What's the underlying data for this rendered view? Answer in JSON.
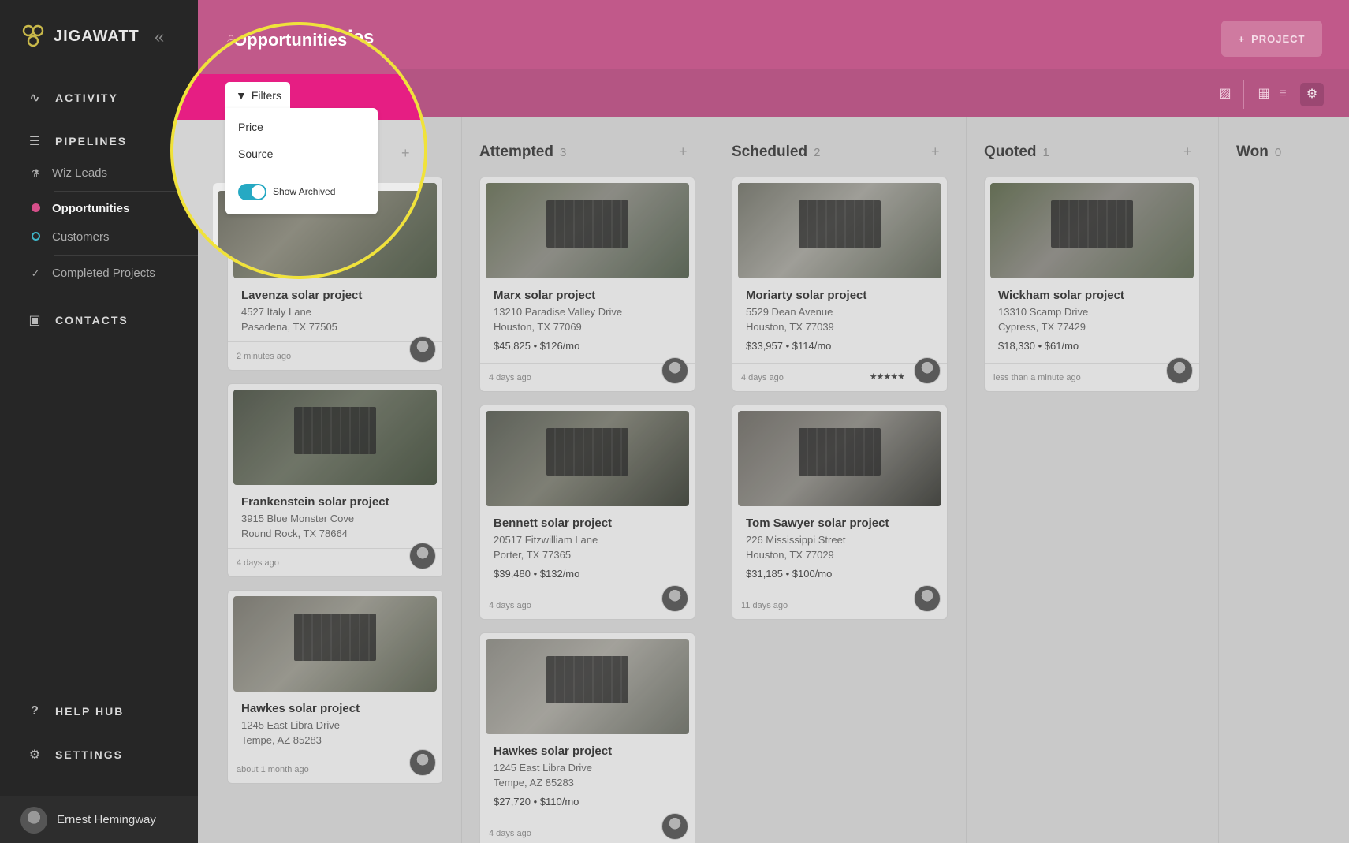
{
  "app": {
    "name": "JIGAWATT"
  },
  "sidebar": {
    "sections": [
      {
        "label": "ACTIVITY",
        "icon": "activity-icon"
      },
      {
        "label": "PIPELINES",
        "icon": "list-icon"
      },
      {
        "label": "CONTACTS",
        "icon": "contact-card-icon"
      },
      {
        "label": "HELP HUB",
        "icon": "help-icon"
      },
      {
        "label": "SETTINGS",
        "icon": "gear-icon"
      }
    ],
    "pipelines": [
      {
        "label": "Wiz Leads",
        "icon": "wizard-icon"
      },
      {
        "label": "Opportunities",
        "icon": "dot-icon",
        "color": "#d64f8a",
        "active": true
      },
      {
        "label": "Customers",
        "icon": "ring-icon",
        "color": "#3fb6c9"
      },
      {
        "label": "Completed Projects",
        "icon": "check-icon"
      }
    ],
    "user": {
      "name": "Ernest Hemingway"
    }
  },
  "header": {
    "title": "Opportunities",
    "project_button": "PROJECT",
    "filters_label": "Filters"
  },
  "filter_menu": {
    "items": [
      "Price",
      "Source"
    ],
    "toggle_label": "Show Archived",
    "toggle_on": true
  },
  "colors": {
    "brand_pink": "#c1598a",
    "hot_pink": "#e61e83",
    "spotlight": "#f0e23a",
    "toggle": "#26a9c3"
  },
  "columns": [
    {
      "name": "",
      "count": "",
      "cards": [
        {
          "title": "Lavenza solar project",
          "addr1": "4527 Italy Lane",
          "addr2": "Pasadena, TX 77505",
          "price": "",
          "time": "2 minutes ago"
        },
        {
          "title": "Frankenstein solar project",
          "addr1": "3915 Blue Monster Cove",
          "addr2": "Round Rock, TX 78664",
          "price": "",
          "time": "4 days ago"
        },
        {
          "title": "Hawkes solar project",
          "addr1": "1245 East Libra Drive",
          "addr2": "Tempe, AZ 85283",
          "price": "",
          "time": "about 1 month ago"
        }
      ]
    },
    {
      "name": "Attempted",
      "count": "3",
      "cards": [
        {
          "title": "Marx solar project",
          "addr1": "13210 Paradise Valley Drive",
          "addr2": "Houston, TX 77069",
          "price": "$45,825  •  $126/mo",
          "time": "4 days ago"
        },
        {
          "title": "Bennett solar project",
          "addr1": "20517 Fitzwilliam Lane",
          "addr2": "Porter, TX 77365",
          "price": "$39,480  •  $132/mo",
          "time": "4 days ago"
        },
        {
          "title": "Hawkes solar project",
          "addr1": "1245 East Libra Drive",
          "addr2": "Tempe, AZ 85283",
          "price": "$27,720  •  $110/mo",
          "time": "4 days ago"
        }
      ]
    },
    {
      "name": "Scheduled",
      "count": "2",
      "cards": [
        {
          "title": "Moriarty solar project",
          "addr1": "5529 Dean Avenue",
          "addr2": "Houston, TX 77039",
          "price": "$33,957  •  $114/mo",
          "time": "4 days ago",
          "stars": "★★★★★"
        },
        {
          "title": "Tom Sawyer solar project",
          "addr1": "226 Mississippi Street",
          "addr2": "Houston, TX 77029",
          "price": "$31,185  •  $100/mo",
          "time": "11 days ago"
        }
      ]
    },
    {
      "name": "Quoted",
      "count": "1",
      "cards": [
        {
          "title": "Wickham solar project",
          "addr1": "13310 Scamp Drive",
          "addr2": "Cypress, TX 77429",
          "price": "$18,330  •  $61/mo",
          "time": "less than a minute ago"
        }
      ]
    },
    {
      "name": "Won",
      "count": "0",
      "cards": []
    }
  ]
}
